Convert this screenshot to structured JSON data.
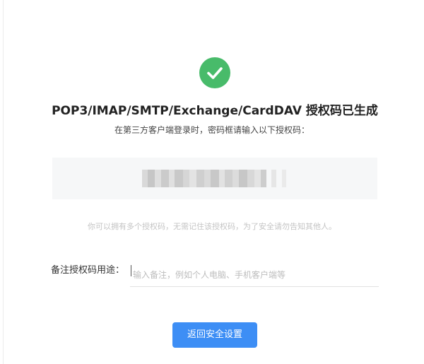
{
  "page": {
    "status_icon": "check-circle-icon",
    "title": "POP3/IMAP/SMTP/Exchange/CardDAV 授权码已生成",
    "subtitle": "在第三方客户端登录时，密码框请输入以下授权码：",
    "auth_code_state": "blurred",
    "hint": "你可以拥有多个授权码，无需记住该授权码，为了安全请勿告知其他人。",
    "remark_label": "备注授权码用途：",
    "remark_placeholder": "输入备注，例如个人电脑、手机客户端等",
    "remark_value": "",
    "back_button_label": "返回安全设置"
  },
  "colors": {
    "success": "#48bb6a",
    "primary": "#3d8ef5",
    "code_background": "#f6f7f8"
  }
}
